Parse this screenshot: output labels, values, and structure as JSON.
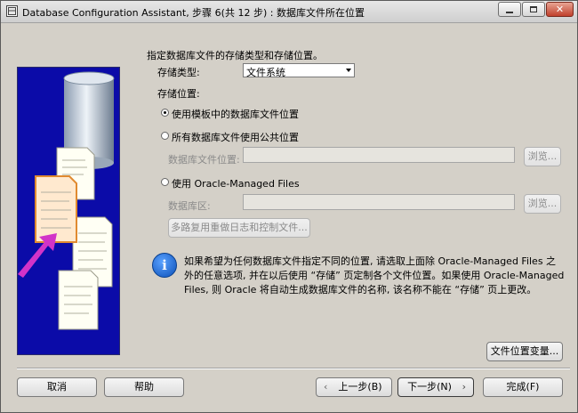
{
  "window": {
    "title": "Database Configuration Assistant, 步骤 6(共 12 步) : 数据库文件所在位置",
    "buttons": {
      "minimize": "minimize",
      "maximize": "maximize",
      "close": "close"
    }
  },
  "form": {
    "heading": "指定数据库文件的存储类型和存储位置。",
    "storage_type_label": "存储类型:",
    "storage_type_value": "文件系统",
    "storage_location_label": "存储位置:",
    "options": [
      {
        "label": "使用模板中的数据库文件位置",
        "selected": true
      },
      {
        "label": "所有数据库文件使用公共位置",
        "selected": false
      },
      {
        "label": "使用 Oracle-Managed Files",
        "selected": false
      }
    ],
    "db_file_location_label": "数据库文件位置:",
    "db_file_location_value": "",
    "browse_label": "浏览...",
    "db_area_label": "数据库区:",
    "db_area_value": "",
    "multiplex_button": "多路复用重做日志和控制文件..."
  },
  "info": {
    "icon": "i",
    "text": "如果希望为任何数据库文件指定不同的位置, 请选取上面除 Oracle-Managed Files 之外的任意选项, 并在以后使用 “存储” 页定制各个文件位置。如果使用 Oracle-Managed Files, 则 Oracle 将自动生成数据库文件的名称, 该名称不能在 “存储” 页上更改。"
  },
  "footer": {
    "file_location_variables": "文件位置变量...",
    "cancel": "取消",
    "help": "帮助",
    "back": "上一步(B)",
    "next": "下一步(N)",
    "finish": "完成(F)"
  }
}
